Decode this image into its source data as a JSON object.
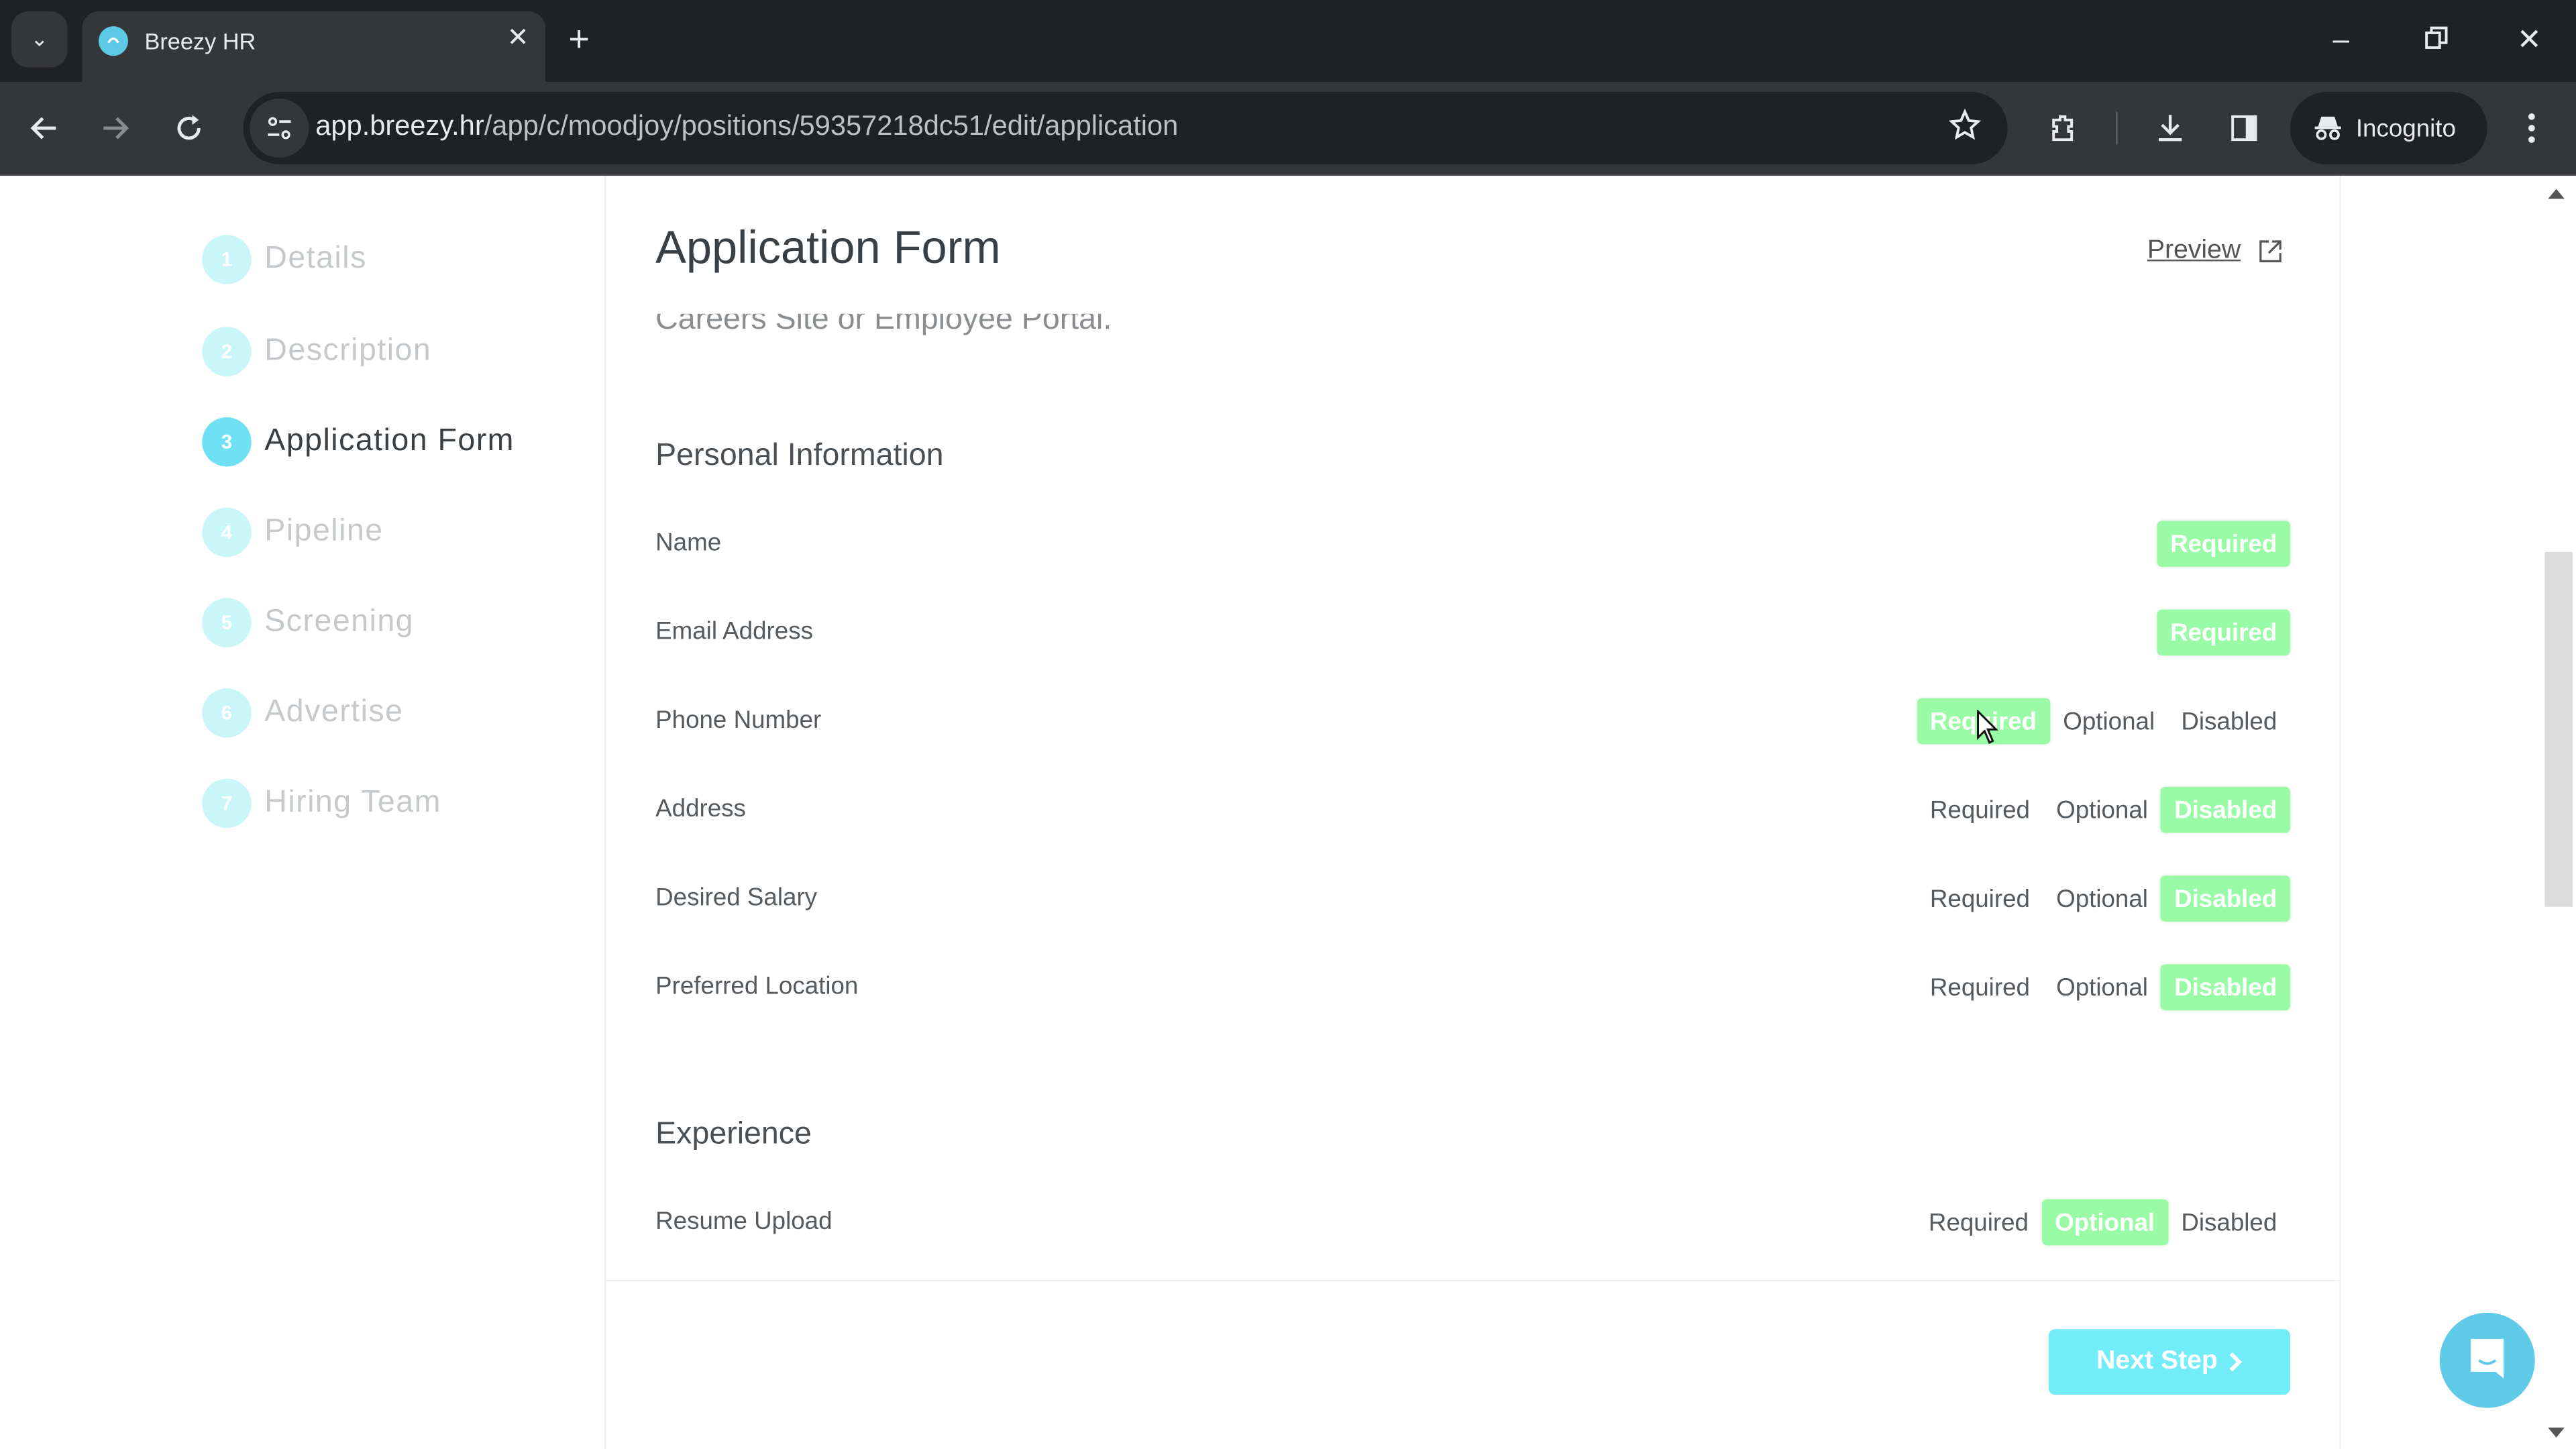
{
  "browser": {
    "tab_title": "Breezy HR",
    "url_host": "app.breezy.hr",
    "url_path": "/app/c/moodjoy/positions/59357218dc51/edit/application",
    "profile_label": "Incognito"
  },
  "sidebar": {
    "steps": [
      {
        "number": "1",
        "label": "Details",
        "active": false
      },
      {
        "number": "2",
        "label": "Description",
        "active": false
      },
      {
        "number": "3",
        "label": "Application Form",
        "active": true
      },
      {
        "number": "4",
        "label": "Pipeline",
        "active": false
      },
      {
        "number": "5",
        "label": "Screening",
        "active": false
      },
      {
        "number": "6",
        "label": "Advertise",
        "active": false
      },
      {
        "number": "7",
        "label": "Hiring Team",
        "active": false
      }
    ]
  },
  "main": {
    "title": "Application Form",
    "preview_label": "Preview",
    "subtext": "Careers Site or Employee Portal.",
    "option_labels": {
      "required": "Required",
      "optional": "Optional",
      "disabled": "Disabled"
    },
    "sections": [
      {
        "title": "Personal Information",
        "fields": [
          {
            "label": "Name",
            "options": [
              "Required"
            ],
            "selected": "Required"
          },
          {
            "label": "Email Address",
            "options": [
              "Required"
            ],
            "selected": "Required"
          },
          {
            "label": "Phone Number",
            "options": [
              "Required",
              "Optional",
              "Disabled"
            ],
            "selected": "Required"
          },
          {
            "label": "Address",
            "options": [
              "Required",
              "Optional",
              "Disabled"
            ],
            "selected": "Disabled"
          },
          {
            "label": "Desired Salary",
            "options": [
              "Required",
              "Optional",
              "Disabled"
            ],
            "selected": "Disabled"
          },
          {
            "label": "Preferred Location",
            "options": [
              "Required",
              "Optional",
              "Disabled"
            ],
            "selected": "Disabled"
          }
        ]
      },
      {
        "title": "Experience",
        "fields": [
          {
            "label": "Resume Upload",
            "options": [
              "Required",
              "Optional",
              "Disabled"
            ],
            "selected": "Optional"
          }
        ]
      }
    ],
    "next_step_label": "Next Step"
  },
  "colors": {
    "selected_option": "#99fba6",
    "accent": "#73ecfa",
    "active_step": "#6fe1f4",
    "inactive_step": "#c9f6f9"
  }
}
